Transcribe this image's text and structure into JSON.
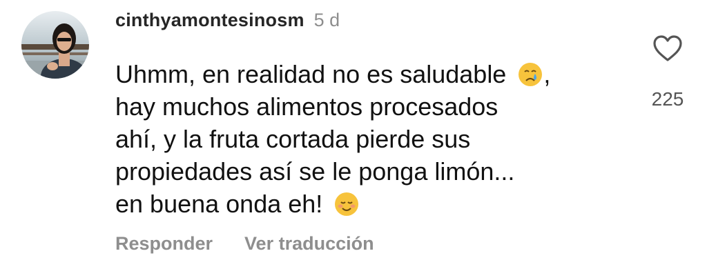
{
  "comment": {
    "username": "cinthyamontesinosm",
    "time": "5 d",
    "lines": [
      "Uhmm, en realidad no es saludable",
      "hay muchos alimentos procesados",
      "ahí, y la fruta cortada pierde sus",
      "propiedades así se le ponga limón...",
      "en buena onda eh!"
    ],
    "line1_suffix": ",",
    "emoji1": "crying-face-emoji",
    "emoji2": "smiling-face-emoji",
    "like_count": "225",
    "actions": {
      "reply": "Responder",
      "translate": "Ver traducción"
    },
    "icons": {
      "like": "heart-outline-icon"
    },
    "colors": {
      "username": "#262626",
      "secondary": "#8e8e8e"
    }
  }
}
